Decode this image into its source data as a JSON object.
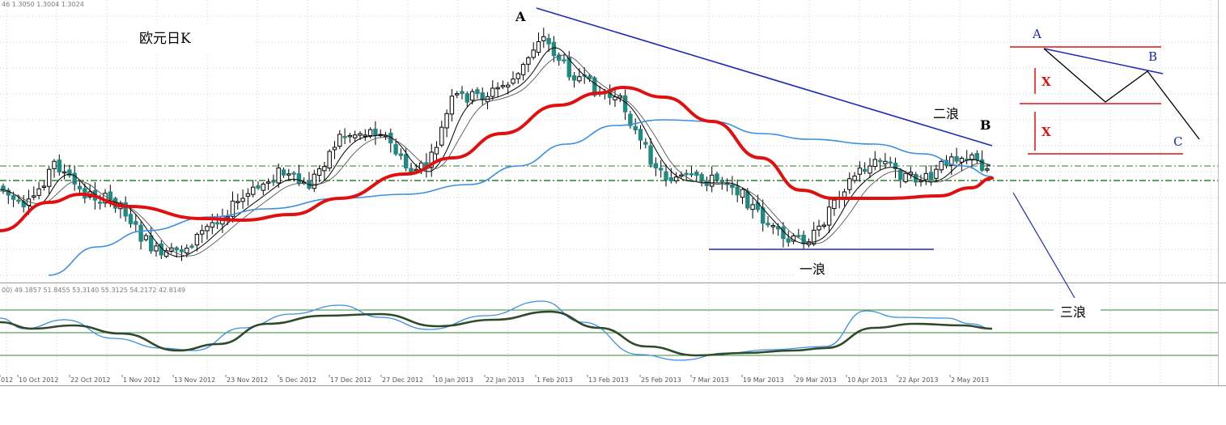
{
  "chart_data": {
    "type": "candlestick",
    "title": "欧元日K",
    "price_header": "46 1.3050 1.3004 1.3024",
    "indicator_header": "00) 49.1857 51.8455 53.3140 55.3125 54.2172 42.8149",
    "x_tick_labels": [
      "012",
      "10 Oct 2012",
      "22 Oct 2012",
      "1 Nov 2012",
      "13 Nov 2012",
      "23 Nov 2012",
      "5 Dec 2012",
      "17 Dec 2012",
      "27 Dec 2012",
      "10 Jan 2013",
      "22 Jan 2013",
      "1 Feb 2013",
      "13 Feb 2013",
      "25 Feb 2013",
      "7 Mar 2013",
      "19 Mar 2013",
      "29 Mar 2013",
      "10 Apr 2013",
      "22 Apr 2013",
      "2 May 2013"
    ],
    "grid": true,
    "colors": {
      "bull_candle": "#000000",
      "bear_candle": "#1e8a82",
      "ma_red": "#e01010",
      "ma_blue": "#3b8fe0",
      "ma_black": "#000000",
      "trendline": "#1c2bb8",
      "osc_main": "#2f4a2a",
      "osc_signal": "#3b8fe0",
      "osc_levels": "#3a8a3a"
    },
    "annotations": {
      "peak_a": "A",
      "point_b": "B",
      "wave1": "一浪",
      "wave2": "二浪",
      "wave3": "三浪"
    },
    "inset_diagram": {
      "labels": [
        "A",
        "B",
        "C"
      ],
      "segment_labels": [
        "X",
        "X"
      ]
    }
  }
}
